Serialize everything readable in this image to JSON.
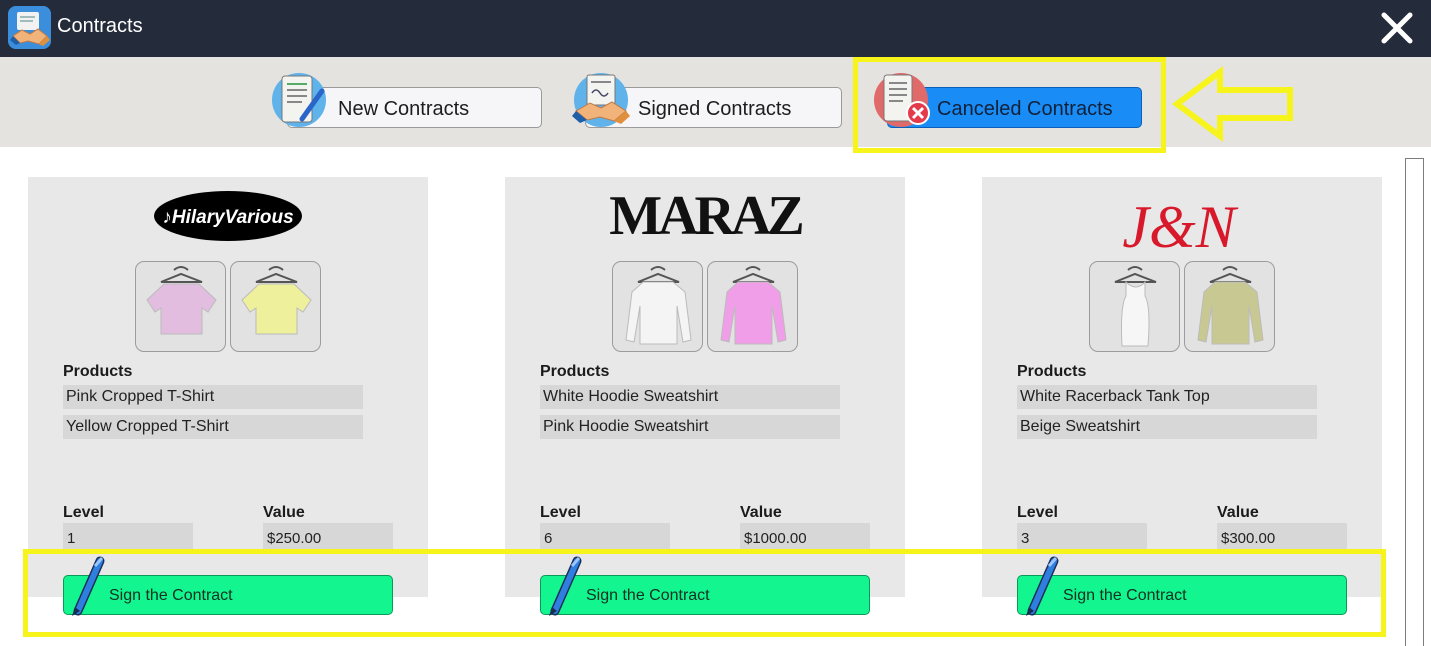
{
  "window": {
    "title": "Contracts",
    "icon": "handshake-icon",
    "close_icon": "close-icon"
  },
  "tabs": [
    {
      "label": "New Contracts",
      "icon": "scroll-pen-icon",
      "active": false
    },
    {
      "label": "Signed Contracts",
      "icon": "signed-document-handshake-icon",
      "active": false
    },
    {
      "label": "Canceled Contracts",
      "icon": "canceled-document-icon",
      "active": true
    }
  ],
  "contracts": [
    {
      "brand": "HilaryVarious",
      "products_label": "Products",
      "products": [
        "Pink Cropped T-Shirt",
        "Yellow Cropped T-Shirt"
      ],
      "product_colors": [
        "#e3bde0",
        "#eef09c"
      ],
      "level_label": "Level",
      "level": "1",
      "value_label": "Value",
      "value": "$250.00",
      "button_label": "Sign the Contract"
    },
    {
      "brand": "MARAZ",
      "products_label": "Products",
      "products": [
        "White Hoodie Sweatshirt",
        "Pink Hoodie Sweatshirt"
      ],
      "product_colors": [
        "#f4f4f4",
        "#f09ee8"
      ],
      "level_label": "Level",
      "level": "6",
      "value_label": "Value",
      "value": "$1000.00",
      "button_label": "Sign the Contract"
    },
    {
      "brand": "J&N",
      "products_label": "Products",
      "products": [
        "White Racerback Tank Top",
        "Beige Sweatshirt"
      ],
      "product_colors": [
        "#f6f6f6",
        "#c8c992"
      ],
      "level_label": "Level",
      "level": "3",
      "value_label": "Value",
      "value": "$300.00",
      "button_label": "Sign the Contract"
    }
  ],
  "colors": {
    "titlebar": "#242c3b",
    "tabbar": "#e4e3df",
    "active_tab": "#1a8cf6",
    "sign_button": "#13f58f",
    "highlight": "#f7f41c"
  }
}
